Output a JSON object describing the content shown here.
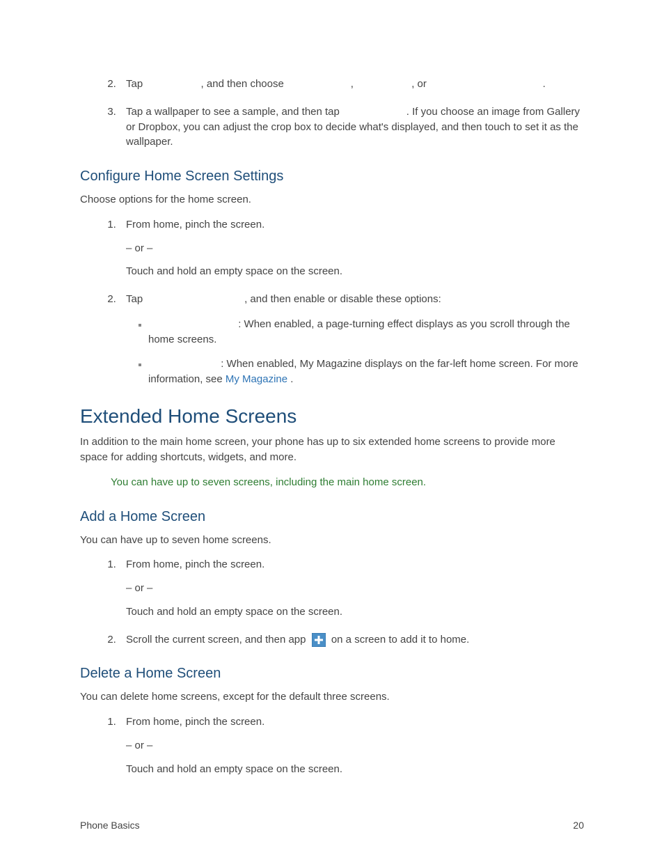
{
  "step2": {
    "t1": "Tap ",
    "t2": ", and then choose ",
    "t3": ", ",
    "t4": ", or ",
    "t5": "."
  },
  "step3": {
    "a": "Tap a wallpaper to see a sample, and then tap ",
    "b": ". If you choose an image from Gallery or Dropbox, you can adjust the crop box to decide what's displayed, and then touch to set it as the wallpaper."
  },
  "configHeading": "Configure Home Screen Settings",
  "configIntro": "Choose options for the home screen.",
  "cfgStep1": {
    "a": "From home, pinch the screen.",
    "or": "– or –",
    "b": "Touch and hold an empty space on the screen."
  },
  "cfgStep2": {
    "t1": "Tap ",
    "t2": ", and then enable or disable these options:"
  },
  "bullet1": {
    "t1": ": When enabled, a page-turning effect displays as you scroll through the home screens."
  },
  "bullet2": {
    "t1": ": When enabled, My Magazine displays on the far-left home screen. For more information, see ",
    "link": "My Magazine",
    "t2": "."
  },
  "extHeading": "Extended Home Screens",
  "extIntro": "In addition to the main home screen, your phone has up to six extended home screens to provide more space for adding shortcuts, widgets, and more.",
  "noteLabel": "",
  "noteText": "You can have up to seven screens, including the main home screen.",
  "addHeading": "Add a Home Screen",
  "addIntro": "You can have up to seven home screens.",
  "addStep1": {
    "a": "From home, pinch the screen.",
    "or": "– or –",
    "b": "Touch and hold an empty space on the screen."
  },
  "addStep2": {
    "a": "Scroll the current screen, and then app ",
    "b": " on a screen to add it to home."
  },
  "delHeading": "Delete a Home Screen",
  "delIntro": "You can delete home screens, except for the default three screens.",
  "delStep1": {
    "a": "From home, pinch the screen.",
    "or": "– or –",
    "b": "Touch and hold an empty space on the screen."
  },
  "footerLeft": "Phone Basics",
  "footerRight": "20"
}
